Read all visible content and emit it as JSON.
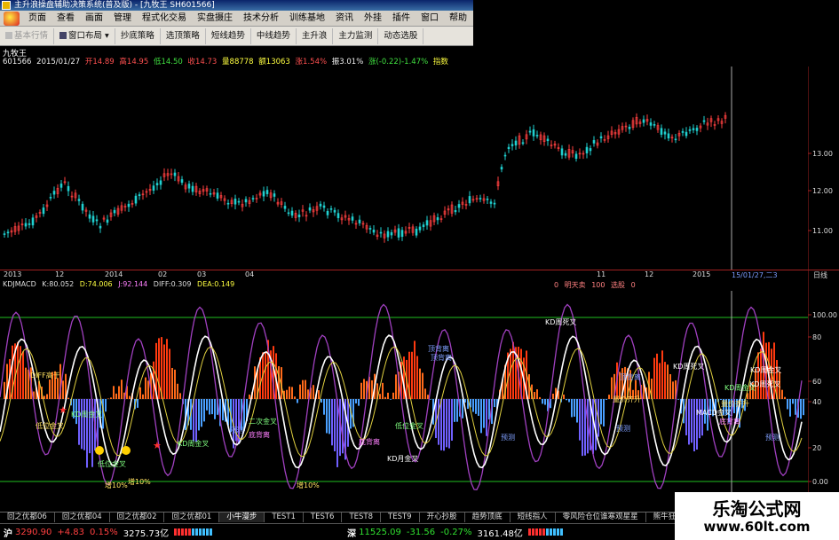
{
  "window": {
    "title": "主升浪操盘辅助决策系统(普及版) - [九牧王  SH601566]"
  },
  "menu": [
    "页面",
    "查看",
    "画面",
    "管理",
    "程式化交易",
    "实盘摄庄",
    "技术分析",
    "训练基地",
    "资讯",
    "外挂",
    "插件",
    "窗口",
    "帮助"
  ],
  "toolbar": [
    "基本行情",
    "窗口布局",
    "抄底策略",
    "选顶策略",
    "短线趋势",
    "中线趋势",
    "主升浪",
    "主力监测",
    "动态选股"
  ],
  "stock": {
    "name": "九牧王",
    "code": "601566",
    "date": "2015/01/27",
    "open": "开14.89",
    "high": "高14.95",
    "low": "低14.50",
    "close": "收14.73",
    "volume": "量88778",
    "amount": "额13063",
    "change": "涨1.54%",
    "amplitude": "振3.01%",
    "diff": "涨(-0.22)-1.47%",
    "indicator": "指数"
  },
  "price_axis": [
    "13.00",
    "12.00",
    "11.00"
  ],
  "indicator_axis": [
    "100.00",
    "80",
    "60",
    "40",
    "20",
    "0.00"
  ],
  "date_axis": [
    "2013",
    "12",
    "2014",
    "02",
    "03",
    "04",
    "11",
    "12",
    "2015"
  ],
  "date_cursor": "15/01/27,二3",
  "period": "日线",
  "indicator_header": {
    "name": "KDJMACD",
    "k": "K:80.052",
    "d": "D:74.006",
    "j": "J:92.144",
    "diff": "DIFF:0.309",
    "dea": "DEA:0.149",
    "right": [
      "0",
      "明天卖",
      "100",
      "选股",
      "0"
    ]
  },
  "annotations": [
    "DIFF高于",
    "顶背离",
    "KD周死叉",
    "顶背离",
    "顶背离",
    "KD周死叉",
    "KD周金叉",
    "低位金叉",
    "KD周金叉",
    "KD周金叉",
    "KD周金叉",
    "二次金叉",
    "底背离",
    "底背离",
    "KD月金叉",
    "低位金叉",
    "低位金叉",
    "增10%",
    "增10%",
    "增10%",
    "MACD金叉",
    "量价齐升",
    "量价齐升",
    "KD周死叉",
    "底背离",
    "预测",
    "预测",
    "预测",
    "预测"
  ],
  "tabs": [
    "回之优都06",
    "回之优都04",
    "回之优都02",
    "回之优都01",
    "小牛漫步",
    "TEST1",
    "TEST6",
    "TEST8",
    "TEST9",
    "开心抄股",
    "趋势顶底",
    "短线指人",
    "零风险仓位谁寒观星星",
    "熊牛狂奔",
    "短"
  ],
  "status": {
    "sh_label": "沪",
    "sh_index": "3290.90",
    "sh_change": "+4.83",
    "sh_pct": "0.15%",
    "sh_amount": "3275.73亿",
    "sz_label": "深",
    "sz_index": "11525.09",
    "sz_change": "-31.56",
    "sz_pct": "-0.27%",
    "sz_amount": "3161.48亿"
  },
  "watermark": {
    "title": "乐淘公式网",
    "url": "www.60lt.com"
  },
  "colors": {
    "up": "#ff4040",
    "down": "#30e030",
    "macd_pos": "#ff6a1a",
    "macd_neg": "#4aa0ff",
    "k_line": "#ffffff",
    "j_line": "#a040c0",
    "grid_line": "#20c020"
  }
}
